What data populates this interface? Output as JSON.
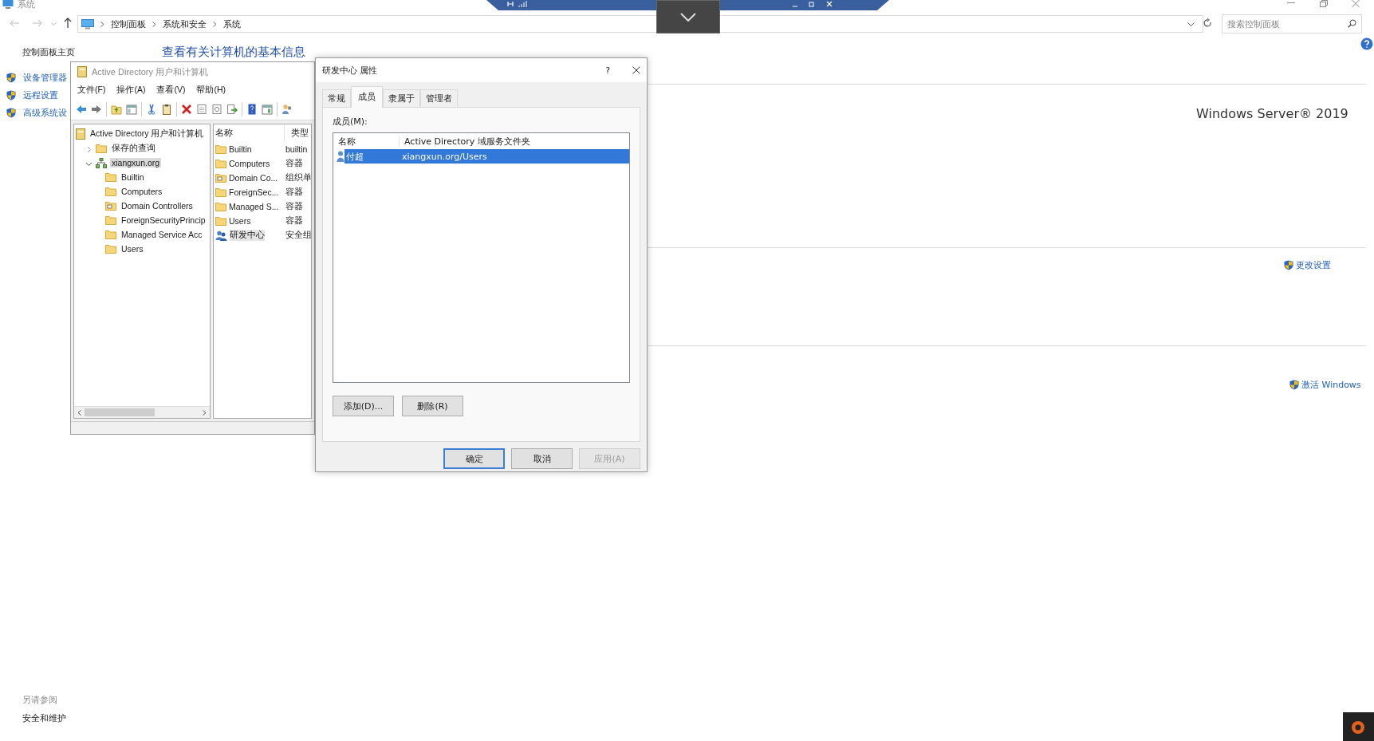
{
  "background_window": {
    "title": "系统",
    "breadcrumb": [
      "控制面板",
      "系统和安全",
      "系统"
    ],
    "search": {
      "placeholder": "搜索控制面板"
    },
    "sidebar": {
      "home": "控制面板主页",
      "links": [
        "设备管理器",
        "远程设置",
        "高级系统设"
      ]
    },
    "heading": "查看有关计算机的基本信息",
    "edition": "Windows Server® 2019",
    "change_settings": "更改设置",
    "activate": "激活 Windows",
    "see_also": {
      "title": "另请参阅",
      "links": [
        "安全和维护"
      ]
    }
  },
  "ad_window": {
    "title": "Active Directory 用户和计算机",
    "menu": [
      "文件(F)",
      "操作(A)",
      "查看(V)",
      "帮助(H)"
    ],
    "tree": {
      "label": "Active Directory 用户和计算机",
      "kind": "root",
      "selected": false,
      "children": [
        {
          "label": "保存的查询",
          "kind": "folder",
          "expanded": false,
          "selected": false
        },
        {
          "label": "xiangxun.org",
          "kind": "domain",
          "expanded": true,
          "selected": true,
          "children": [
            {
              "label": "Builtin",
              "kind": "folder",
              "selected": false
            },
            {
              "label": "Computers",
              "kind": "folder",
              "selected": false
            },
            {
              "label": "Domain Controllers",
              "kind": "ou",
              "selected": false
            },
            {
              "label": "ForeignSecurityPrincip",
              "kind": "folder",
              "selected": false
            },
            {
              "label": "Managed Service Acc",
              "kind": "folder",
              "selected": false
            },
            {
              "label": "Users",
              "kind": "folder",
              "selected": false
            }
          ]
        }
      ]
    },
    "list": {
      "columns": [
        "名称",
        "类型"
      ],
      "rows": [
        {
          "name": "Builtin",
          "type": "builtin",
          "kind": "folder",
          "selected": false
        },
        {
          "name": "Computers",
          "type": "容器",
          "kind": "folder",
          "selected": false
        },
        {
          "name": "Domain Co...",
          "type": "组织单",
          "kind": "ou",
          "selected": false
        },
        {
          "name": "ForeignSec...",
          "type": "容器",
          "kind": "folder",
          "selected": false
        },
        {
          "name": "Managed S...",
          "type": "容器",
          "kind": "folder",
          "selected": false
        },
        {
          "name": "Users",
          "type": "容器",
          "kind": "folder",
          "selected": false
        },
        {
          "name": "研发中心",
          "type": "安全组",
          "kind": "group",
          "selected": true
        }
      ]
    }
  },
  "dialog": {
    "title": "研发中心 属性",
    "help": "?",
    "tabs": [
      {
        "label": "常规",
        "selected": false
      },
      {
        "label": "成员",
        "selected": true
      },
      {
        "label": "隶属于",
        "selected": false
      },
      {
        "label": "管理者",
        "selected": false
      }
    ],
    "members_label": "成员(M):",
    "columns": [
      "名称",
      "Active Directory 域服务文件夹"
    ],
    "members": [
      {
        "name": "付超",
        "folder": "xiangxun.org/Users",
        "selected": true
      }
    ],
    "add_button": "添加(D)...",
    "remove_button": "删除(R)",
    "buttons": [
      {
        "label": "确定",
        "default": true,
        "disabled": false
      },
      {
        "label": "取消",
        "default": false,
        "disabled": false
      },
      {
        "label": "应用(A)",
        "default": false,
        "disabled": true
      }
    ]
  }
}
